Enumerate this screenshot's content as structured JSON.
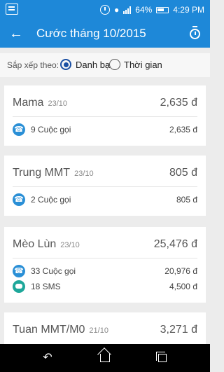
{
  "status_bar": {
    "battery_percent": "64%",
    "time": "4:29 PM"
  },
  "app_bar": {
    "title": "Cước tháng 10/2015"
  },
  "sort": {
    "label": "Sắp xếp theo:",
    "options": [
      {
        "label": "Danh bạ",
        "checked": true
      },
      {
        "label": "Thời gian",
        "checked": false
      }
    ]
  },
  "contacts": [
    {
      "name": "Mama",
      "date": "23/10",
      "total": "2,635 đ",
      "lines": [
        {
          "icon": "phone-icon",
          "label": "9 Cuộc gọi",
          "amount": "2,635 đ"
        }
      ]
    },
    {
      "name": "Trung MMT",
      "date": "23/10",
      "total": "805 đ",
      "lines": [
        {
          "icon": "phone-icon",
          "label": "2 Cuộc gọi",
          "amount": "805 đ"
        }
      ]
    },
    {
      "name": "Mèo Lùn",
      "date": "23/10",
      "total": "25,476 đ",
      "lines": [
        {
          "icon": "phone-icon",
          "label": "33 Cuộc gọi",
          "amount": "20,976 đ"
        },
        {
          "icon": "sms-icon",
          "label": "18 SMS",
          "amount": "4,500 đ"
        }
      ]
    },
    {
      "name": "Tuan MMT/M0",
      "date": "21/10",
      "total": "3,271 đ",
      "lines": []
    }
  ],
  "colors": {
    "app_bar": "#1e88d8",
    "phone_icon": "#2a8fd6",
    "sms_icon": "#1ea79a",
    "radio_selected": "#1a4fa3"
  }
}
